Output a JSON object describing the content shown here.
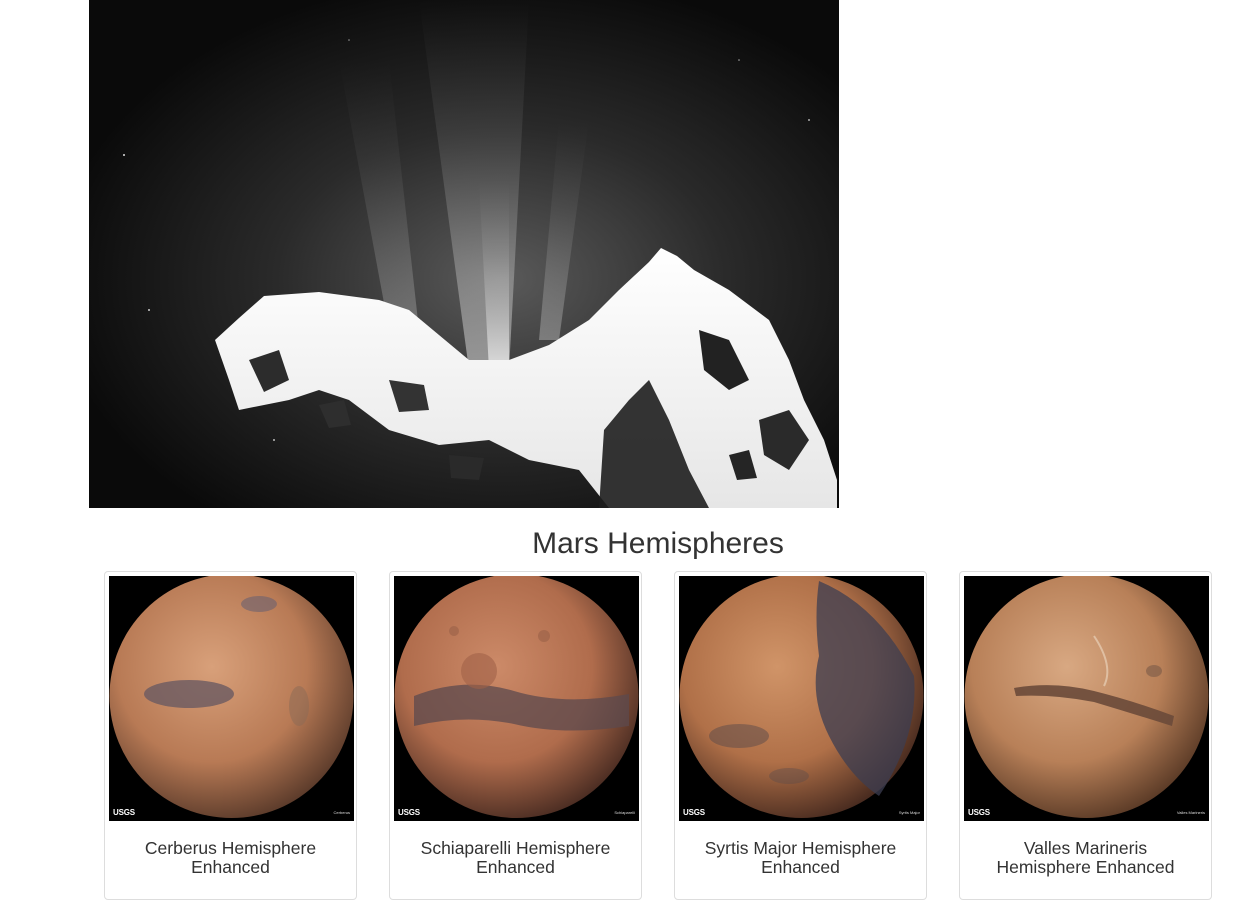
{
  "featured_image": {
    "alt_icon": "comet-image"
  },
  "section": {
    "title": "Mars Hemispheres"
  },
  "hemispheres": [
    {
      "title": "Cerberus Hemisphere Enhanced",
      "logo": "USGS",
      "tag": "Cerberus",
      "colors": {
        "base": "#b87a55",
        "light": "#d8a07a",
        "dark": "#6a5a62"
      }
    },
    {
      "title": "Schiaparelli Hemisphere Enhanced",
      "logo": "USGS",
      "tag": "Schiaparelli",
      "colors": {
        "base": "#b06c4c",
        "light": "#cc8a68",
        "dark": "#5c4a4e"
      }
    },
    {
      "title": "Syrtis Major Hemisphere Enhanced",
      "logo": "USGS",
      "tag": "Syrtis Major",
      "colors": {
        "base": "#b07048",
        "light": "#d09468",
        "dark": "#3c3e52"
      }
    },
    {
      "title": "Valles Marineris Hemisphere Enhanced",
      "logo": "USGS",
      "tag": "Valles Marineris",
      "colors": {
        "base": "#b88058",
        "light": "#d8a882",
        "dark": "#6a4a3a"
      }
    }
  ]
}
